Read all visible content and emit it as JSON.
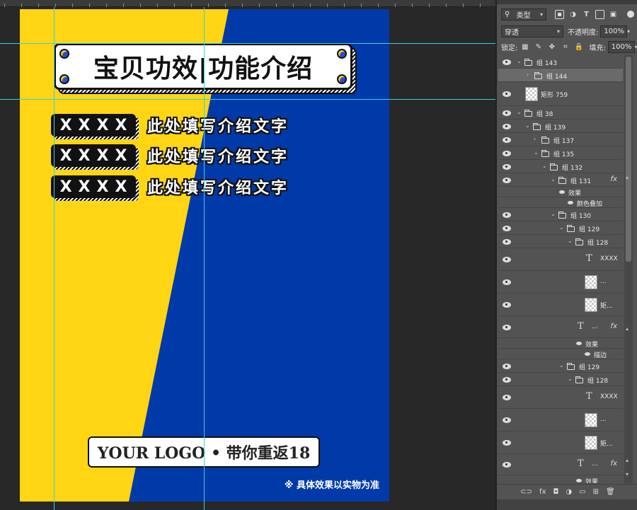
{
  "canvas": {
    "title_badge_text": "宝贝功效|功能介绍",
    "features": [
      {
        "tag": "XXXX",
        "text": "此处填写介绍文字"
      },
      {
        "tag": "XXXX",
        "text": "此处填写介绍文字"
      },
      {
        "tag": "XXXX",
        "text": "此处填写介绍文字"
      }
    ],
    "logo_text": "YOUR LOGO • 带你重返18",
    "disclaimer": "※ 具体效果以实物为准",
    "colors": {
      "yellow": "#ffd514",
      "blue": "#003aa8",
      "guide": "#3ad0e0"
    }
  },
  "layers_panel": {
    "filter_kind": "类型",
    "blend_mode": "穿透",
    "opacity_label": "不透明度:",
    "opacity_value": "100%",
    "lock_label": "锁定:",
    "fill_label": "填充:",
    "fill_value": "100%",
    "layers": [
      {
        "name": "组 143",
        "kind": "group",
        "expanded": true
      },
      {
        "name": "组 144",
        "kind": "group",
        "expanded": false,
        "selected": true
      },
      {
        "name": "矩形 759",
        "kind": "shape"
      },
      {
        "name": "组 38",
        "kind": "group",
        "expanded": true
      },
      {
        "name": "组 139",
        "kind": "group",
        "expanded": true
      },
      {
        "name": "组 137",
        "kind": "group",
        "expanded": false
      },
      {
        "name": "组 135",
        "kind": "group",
        "expanded": true
      },
      {
        "name": "组 132",
        "kind": "group",
        "expanded": true
      },
      {
        "name": "组 131",
        "kind": "group",
        "expanded": true,
        "fx": true
      },
      {
        "name": "效果",
        "kind": "effect"
      },
      {
        "name": "颜色叠加",
        "kind": "effect-item"
      },
      {
        "name": "组 130",
        "kind": "group",
        "expanded": true
      },
      {
        "name": "组 129",
        "kind": "group",
        "expanded": true
      },
      {
        "name": "组 128",
        "kind": "group",
        "expanded": true
      },
      {
        "name": "XXXX",
        "kind": "text"
      },
      {
        "name": "...",
        "kind": "smart"
      },
      {
        "name": "矩...",
        "kind": "smart"
      },
      {
        "name": "...",
        "kind": "text",
        "fx": true
      },
      {
        "name": "效果",
        "kind": "effect"
      },
      {
        "name": "描边",
        "kind": "effect-item"
      },
      {
        "name": "组 129",
        "kind": "group",
        "expanded": true
      },
      {
        "name": "组 128",
        "kind": "group",
        "expanded": true
      },
      {
        "name": "XXXX",
        "kind": "text"
      },
      {
        "name": "...",
        "kind": "smart"
      },
      {
        "name": "矩...",
        "kind": "smart"
      },
      {
        "name": "...",
        "kind": "text",
        "fx": true
      },
      {
        "name": "效果",
        "kind": "effect"
      }
    ],
    "bottom_icons": [
      "link-icon",
      "fx-icon",
      "mask-icon",
      "adjustment-icon",
      "folder-icon",
      "new-layer-icon",
      "trash-icon"
    ],
    "bottom_glyphs": [
      "⊂⊃",
      "fx",
      "◘",
      "◑",
      "▭",
      "⊞",
      "🗑"
    ]
  }
}
